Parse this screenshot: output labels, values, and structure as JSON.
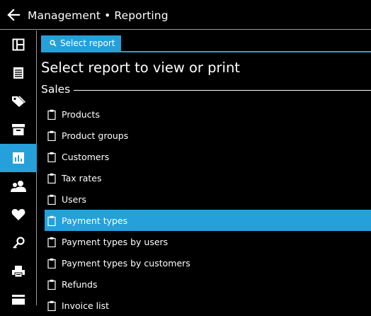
{
  "header": {
    "title": "Management • Reporting"
  },
  "sidebar": {
    "items": [
      {
        "icon": "dashboard-icon",
        "active": false
      },
      {
        "icon": "document-list-icon",
        "active": false
      },
      {
        "icon": "tags-icon",
        "active": false
      },
      {
        "icon": "archive-box-icon",
        "active": false
      },
      {
        "icon": "bar-chart-icon",
        "active": true
      },
      {
        "icon": "users-icon",
        "active": false
      },
      {
        "icon": "heart-icon",
        "active": false
      },
      {
        "icon": "key-icon",
        "active": false
      },
      {
        "icon": "printer-icon",
        "active": false
      },
      {
        "icon": "credit-card-icon",
        "active": false
      }
    ]
  },
  "tab": {
    "label": "Select report"
  },
  "main": {
    "heading": "Select report to view or print",
    "section_title": "Sales",
    "reports": [
      {
        "label": "Products"
      },
      {
        "label": "Product groups"
      },
      {
        "label": "Customers"
      },
      {
        "label": "Tax rates"
      },
      {
        "label": "Users"
      },
      {
        "label": "Payment types",
        "selected": true
      },
      {
        "label": "Payment types by users"
      },
      {
        "label": "Payment types by customers"
      },
      {
        "label": "Refunds"
      },
      {
        "label": "Invoice list"
      }
    ]
  },
  "colors": {
    "accent": "#26a0da",
    "background": "#000000",
    "text": "#ffffff"
  }
}
